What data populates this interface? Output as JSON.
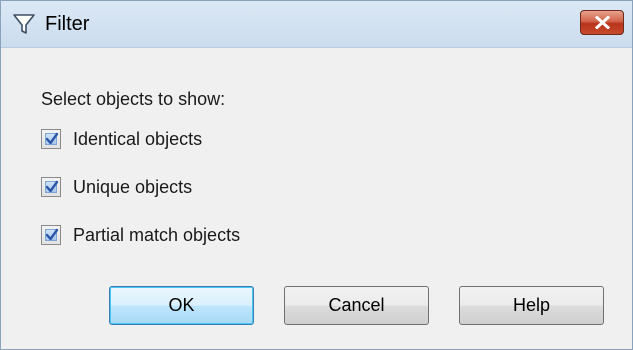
{
  "window": {
    "title": "Filter",
    "title_icon": "filter-funnel-icon",
    "close_icon": "close-icon"
  },
  "content": {
    "instruction": "Select objects to show:",
    "options": [
      {
        "label": "Identical objects",
        "checked": true
      },
      {
        "label": "Unique objects",
        "checked": true
      },
      {
        "label": "Partial match objects",
        "checked": true
      }
    ]
  },
  "buttons": {
    "ok": "OK",
    "cancel": "Cancel",
    "help": "Help"
  },
  "colors": {
    "close_button": "#c7492c",
    "default_button_border": "#3c7fb1",
    "titlebar": "#cbdcee",
    "checkmark": "#2b56a8"
  }
}
